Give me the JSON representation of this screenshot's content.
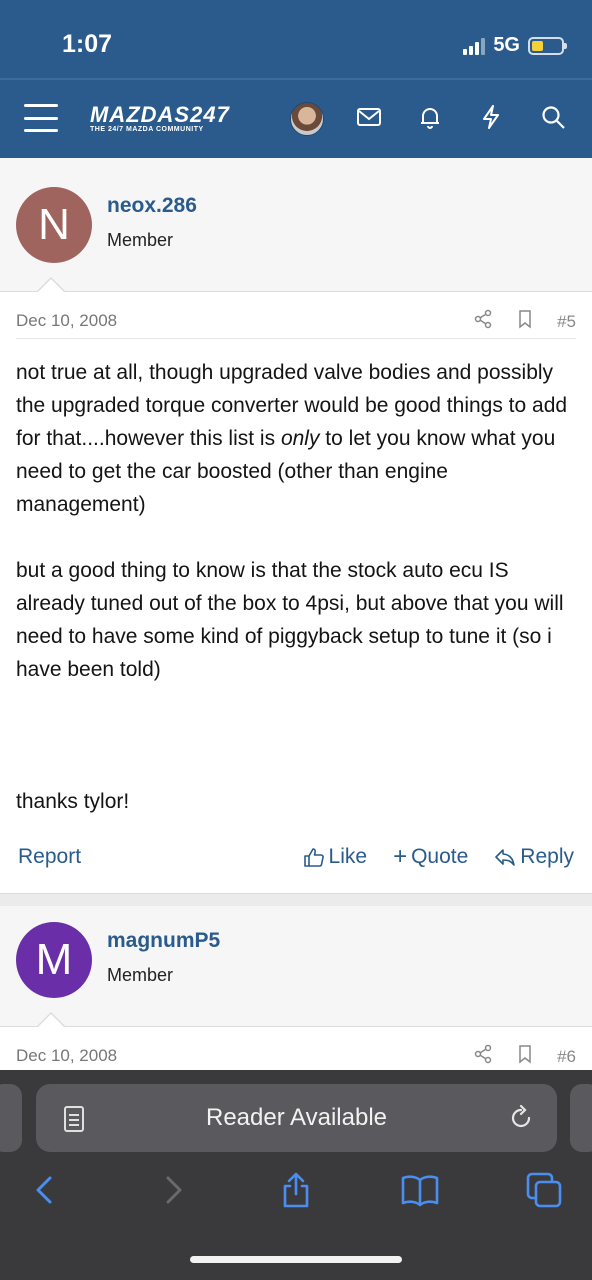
{
  "status_bar": {
    "time": "1:07",
    "network": "5G",
    "battery_level": 0.4
  },
  "nav": {
    "logo_text": "MAZDAS247",
    "logo_tagline": "THE 24/7 MAZDA COMMUNITY",
    "icons": [
      "menu-icon",
      "avatar",
      "mail-icon",
      "bell-icon",
      "bolt-icon",
      "search-icon"
    ]
  },
  "posts": [
    {
      "avatar_letter": "N",
      "avatar_color": "#a0645e",
      "username": "neox.286",
      "user_title": "Member",
      "date": "Dec 10, 2008",
      "post_number": "#5",
      "body": {
        "p1_before": "not true at all, though upgraded valve bodies and possibly the upgraded torque converter would be good things to add for that....however this list is ",
        "p1_em": "only",
        "p1_after": " to let you know what you need to get the car boosted (other than engine management)",
        "p2": "but a good thing to know is that the stock auto ecu IS already tuned out of the box to 4psi, but above that you will need to have some kind of piggyback setup to tune it (so i have been told)",
        "p3": "thanks tylor!"
      },
      "actions": {
        "report": "Report",
        "like": "Like",
        "quote": "Quote",
        "reply": "Reply"
      }
    },
    {
      "avatar_letter": "M",
      "avatar_color": "#6a2fa8",
      "username": "magnumP5",
      "user_title": "Member",
      "date": "Dec 10, 2008",
      "post_number": "#6"
    }
  ],
  "safari": {
    "reader_label": "Reader Available"
  },
  "colors": {
    "brand": "#2a5b8c",
    "link": "#2a5b8c"
  }
}
